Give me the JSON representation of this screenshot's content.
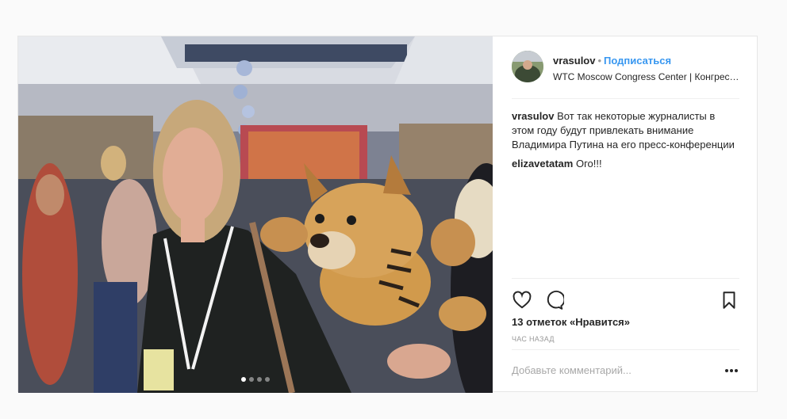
{
  "post": {
    "username": "vrasulov",
    "separator": "•",
    "follow_label": "Подписаться",
    "location": "WTC Moscow Congress Center | Конгресс…",
    "caption_user": "vrasulov",
    "caption_text": "Вот так некоторые журналисты в этом году будут привлекать внимание Владимира Путина на его пресс-конференции",
    "comments": [
      {
        "user": "elizavetatam",
        "text": "Ого!!!"
      }
    ],
    "likes": "13 отметок «Нравится»",
    "time": "час назад",
    "comment_placeholder": "Добавьте комментарий...",
    "carousel": {
      "count": 4,
      "active_index": 0
    }
  },
  "icons": {
    "like": "heart-icon",
    "comment": "comment-bubble-icon",
    "save": "bookmark-icon",
    "more": "more-options-icon"
  },
  "colors": {
    "accent": "#3897f0",
    "text": "#262626",
    "muted": "#999999",
    "border": "#efefef"
  }
}
